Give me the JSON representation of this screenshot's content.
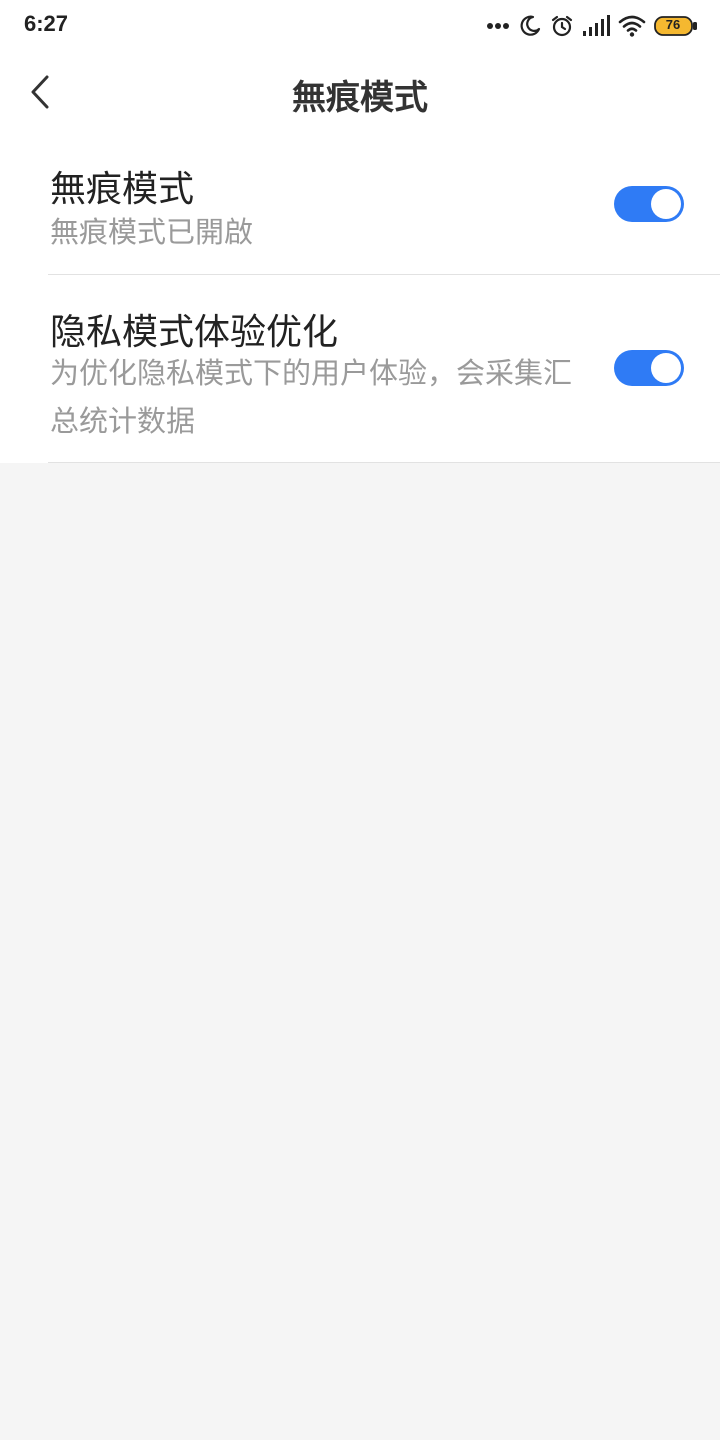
{
  "status_bar": {
    "time": "6:27",
    "icons": [
      "more-dots-icon",
      "moon-icon",
      "alarm-icon",
      "signal-icon",
      "wifi-icon",
      "battery-icon"
    ],
    "battery_level": "76",
    "battery_color": "#f5b830"
  },
  "header": {
    "title": "無痕模式",
    "back_icon": "chevron-left-icon"
  },
  "settings": [
    {
      "title": "無痕模式",
      "description": "無痕模式已開啟",
      "enabled": true
    },
    {
      "title": "隐私模式体验优化",
      "description": "为优化隐私模式下的用户体验，会采集汇总统计数据",
      "enabled": true
    }
  ],
  "colors": {
    "accent": "#2f7bf5",
    "background": "#f5f5f5",
    "surface": "#ffffff"
  }
}
